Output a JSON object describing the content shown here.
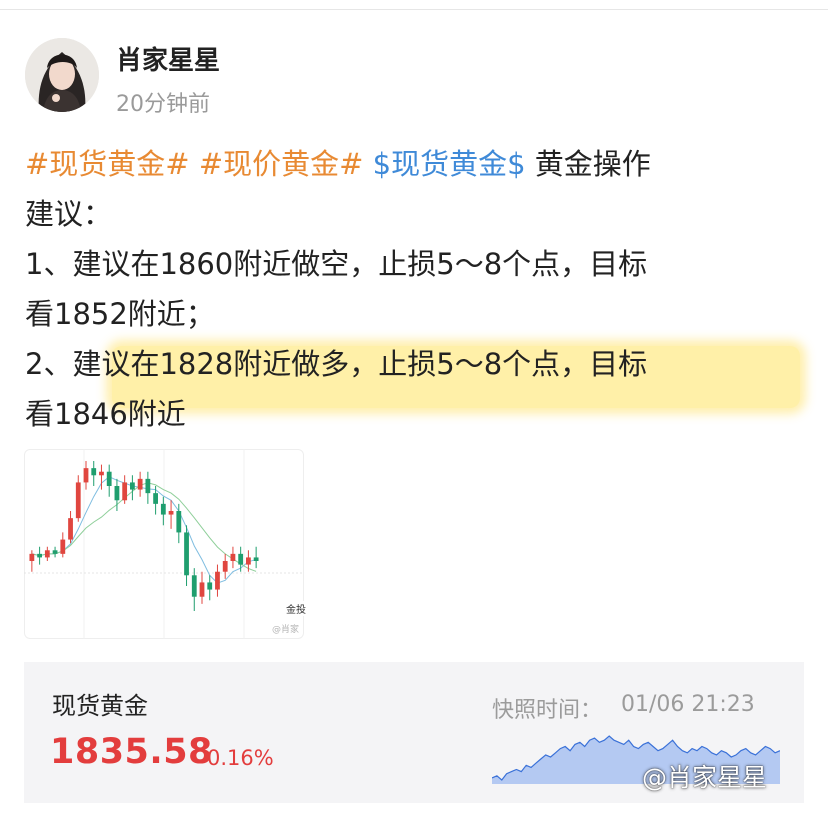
{
  "post": {
    "author": "肖家星星",
    "time": "20分钟前",
    "hashtags": [
      "#现货黄金#",
      "#现价黄金#"
    ],
    "stock_tag": "$现货黄金$",
    "lines": [
      "黄金操作",
      "建议：",
      "1、建议在1860附近做空，止损5～8个点，目标",
      "看1852附近；",
      "2、建议在1828附近做多，止损5～8个点，目标",
      "看1846附近"
    ]
  },
  "attachment": {
    "label": "金投",
    "watermark": "@肖家",
    "candles": [
      {
        "o": 1832,
        "c": 1834,
        "h": 1835,
        "l": 1829
      },
      {
        "o": 1834,
        "c": 1833,
        "h": 1836,
        "l": 1831
      },
      {
        "o": 1833,
        "c": 1835,
        "h": 1836,
        "l": 1832
      },
      {
        "o": 1835,
        "c": 1834,
        "h": 1836,
        "l": 1833
      },
      {
        "o": 1834,
        "c": 1838,
        "h": 1840,
        "l": 1833
      },
      {
        "o": 1838,
        "c": 1844,
        "h": 1846,
        "l": 1837
      },
      {
        "o": 1844,
        "c": 1854,
        "h": 1856,
        "l": 1843
      },
      {
        "o": 1854,
        "c": 1858,
        "h": 1860,
        "l": 1852
      },
      {
        "o": 1858,
        "c": 1856,
        "h": 1860,
        "l": 1853
      },
      {
        "o": 1856,
        "c": 1857,
        "h": 1859,
        "l": 1852
      },
      {
        "o": 1857,
        "c": 1853,
        "h": 1859,
        "l": 1850
      },
      {
        "o": 1853,
        "c": 1849,
        "h": 1855,
        "l": 1846
      },
      {
        "o": 1849,
        "c": 1854,
        "h": 1856,
        "l": 1848
      },
      {
        "o": 1854,
        "c": 1852,
        "h": 1856,
        "l": 1849
      },
      {
        "o": 1852,
        "c": 1855,
        "h": 1857,
        "l": 1850
      },
      {
        "o": 1855,
        "c": 1851,
        "h": 1857,
        "l": 1848
      },
      {
        "o": 1851,
        "c": 1848,
        "h": 1853,
        "l": 1845
      },
      {
        "o": 1848,
        "c": 1845,
        "h": 1850,
        "l": 1842
      },
      {
        "o": 1845,
        "c": 1846,
        "h": 1849,
        "l": 1841
      },
      {
        "o": 1846,
        "c": 1840,
        "h": 1848,
        "l": 1837
      },
      {
        "o": 1840,
        "c": 1828,
        "h": 1842,
        "l": 1825
      },
      {
        "o": 1828,
        "c": 1822,
        "h": 1830,
        "l": 1818
      },
      {
        "o": 1822,
        "c": 1826,
        "h": 1829,
        "l": 1820
      },
      {
        "o": 1826,
        "c": 1824,
        "h": 1828,
        "l": 1821
      },
      {
        "o": 1824,
        "c": 1829,
        "h": 1831,
        "l": 1822
      },
      {
        "o": 1829,
        "c": 1832,
        "h": 1834,
        "l": 1827
      },
      {
        "o": 1832,
        "c": 1834,
        "h": 1836,
        "l": 1830
      },
      {
        "o": 1834,
        "c": 1831,
        "h": 1836,
        "l": 1829
      },
      {
        "o": 1831,
        "c": 1833,
        "h": 1835,
        "l": 1829
      },
      {
        "o": 1833,
        "c": 1832,
        "h": 1836,
        "l": 1830
      }
    ]
  },
  "quote": {
    "name": "现货黄金",
    "price": "1835.58",
    "change": "0.16%",
    "snapshot_label": "快照时间：",
    "snapshot_time": "01/06 21:23",
    "sparkline": [
      1828,
      1829,
      1827,
      1830,
      1831,
      1832,
      1831,
      1834,
      1833,
      1835,
      1837,
      1839,
      1838,
      1840,
      1842,
      1843,
      1841,
      1844,
      1845,
      1843,
      1846,
      1847,
      1845,
      1846,
      1848,
      1846,
      1845,
      1844,
      1846,
      1843,
      1842,
      1844,
      1845,
      1843,
      1841,
      1842,
      1844,
      1846,
      1843,
      1841,
      1840,
      1842,
      1841,
      1843,
      1842,
      1840,
      1839,
      1841,
      1840,
      1838,
      1839,
      1841,
      1842,
      1840,
      1839,
      1841,
      1843,
      1842,
      1840,
      1841
    ],
    "up_color": "#e33d3d",
    "spark_color": "#3a71d8"
  },
  "watermark": "@肖家星星",
  "colors": {
    "hashtag": "#e88a33",
    "stock_tag": "#3f8ad8",
    "highlight": "#fff0a8"
  }
}
